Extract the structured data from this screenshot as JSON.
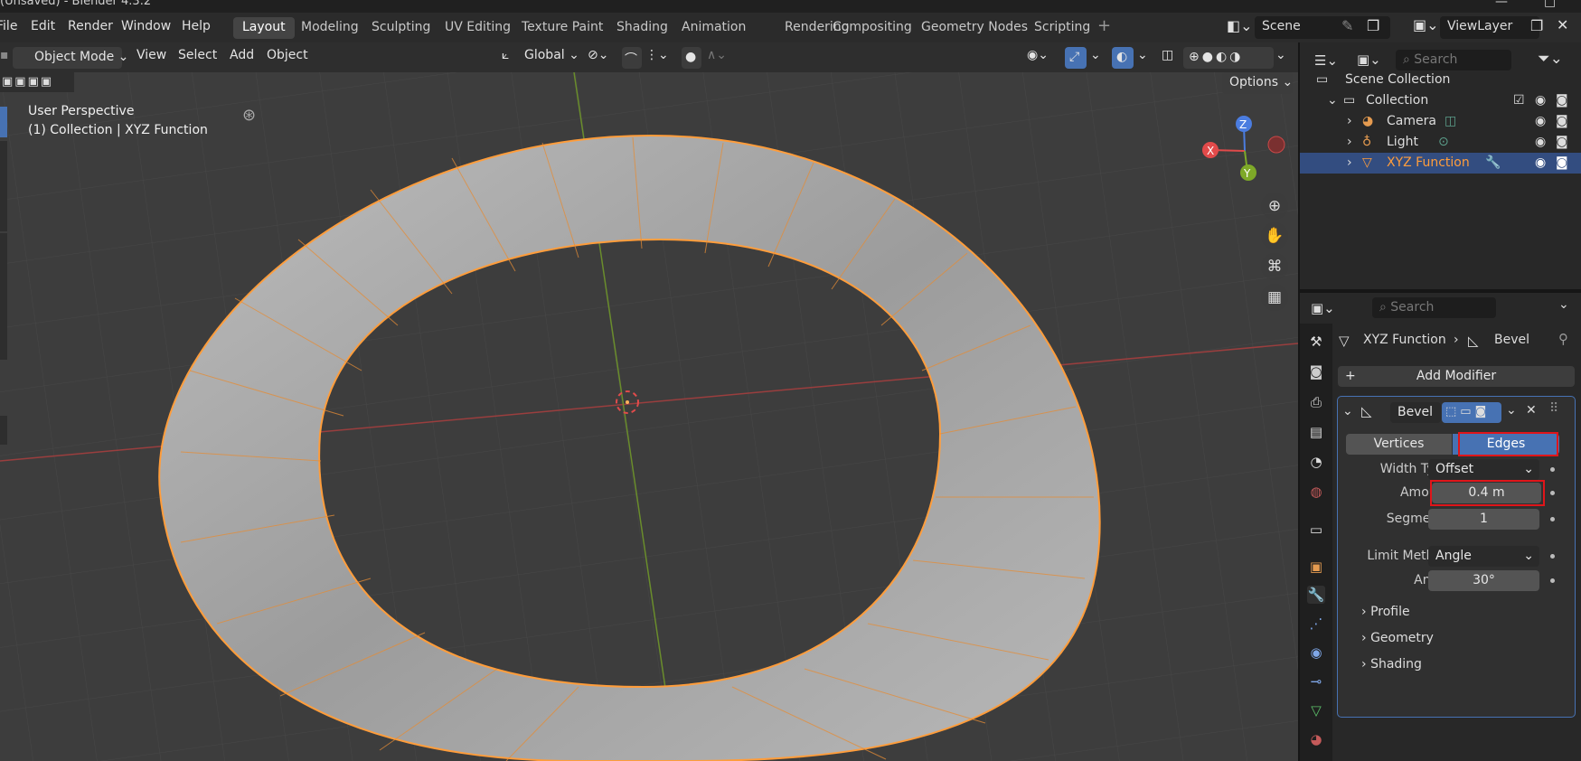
{
  "window": {
    "title": "(Unsaved) - Blender 4.3.2",
    "controls": [
      "—",
      "□"
    ]
  },
  "menu": {
    "items": [
      "File",
      "Edit",
      "Render",
      "Window",
      "Help"
    ]
  },
  "workspaces": [
    "Layout",
    "Modeling",
    "Sculpting",
    "UV Editing",
    "Texture Paint",
    "Shading",
    "Animation",
    "Rendering",
    "Compositing",
    "Geometry Nodes",
    "Scripting"
  ],
  "scene": {
    "name": "Scene",
    "view_layer": "ViewLayer"
  },
  "viewport_header": {
    "mode": "Object Mode",
    "menus": [
      "View",
      "Select",
      "Add",
      "Object"
    ],
    "transform_orientation": "Global",
    "options_label": "Options"
  },
  "viewport": {
    "perspective_label": "User Perspective",
    "context_label": "(1) Collection | XYZ Function",
    "gizmo": {
      "z": "Z",
      "x": "X",
      "y": "Y"
    }
  },
  "outliner": {
    "search_placeholder": "Search",
    "scene_collection": "Scene Collection",
    "collection": "Collection",
    "items": [
      {
        "label": "Camera",
        "selected": false
      },
      {
        "label": "Light",
        "selected": false
      },
      {
        "label": "XYZ Function",
        "selected": true
      }
    ]
  },
  "properties": {
    "search_placeholder": "Search",
    "breadcrumb": {
      "object": "XYZ Function",
      "modifier": "Bevel"
    },
    "add_modifier": "Add Modifier",
    "modifier": {
      "name": "Bevel",
      "affect": {
        "vertices": "Vertices",
        "edges": "Edges",
        "selected": "Edges"
      },
      "width_type_label": "Width Type",
      "width_type": "Offset",
      "amount_label": "Amount",
      "amount": "0.4 m",
      "segments_label": "Segments",
      "segments": "1",
      "limit_method_label": "Limit Method",
      "limit_method": "Angle",
      "angle_label": "Angle",
      "angle": "30°",
      "subpanels": [
        "Profile",
        "Geometry",
        "Shading"
      ]
    }
  },
  "colors": {
    "accent_blue": "#4772b3",
    "selection_orange": "#ff9d3b",
    "highlight_red": "#e0151a",
    "x_axis": "#e24a4a",
    "y_axis": "#7ea928"
  }
}
